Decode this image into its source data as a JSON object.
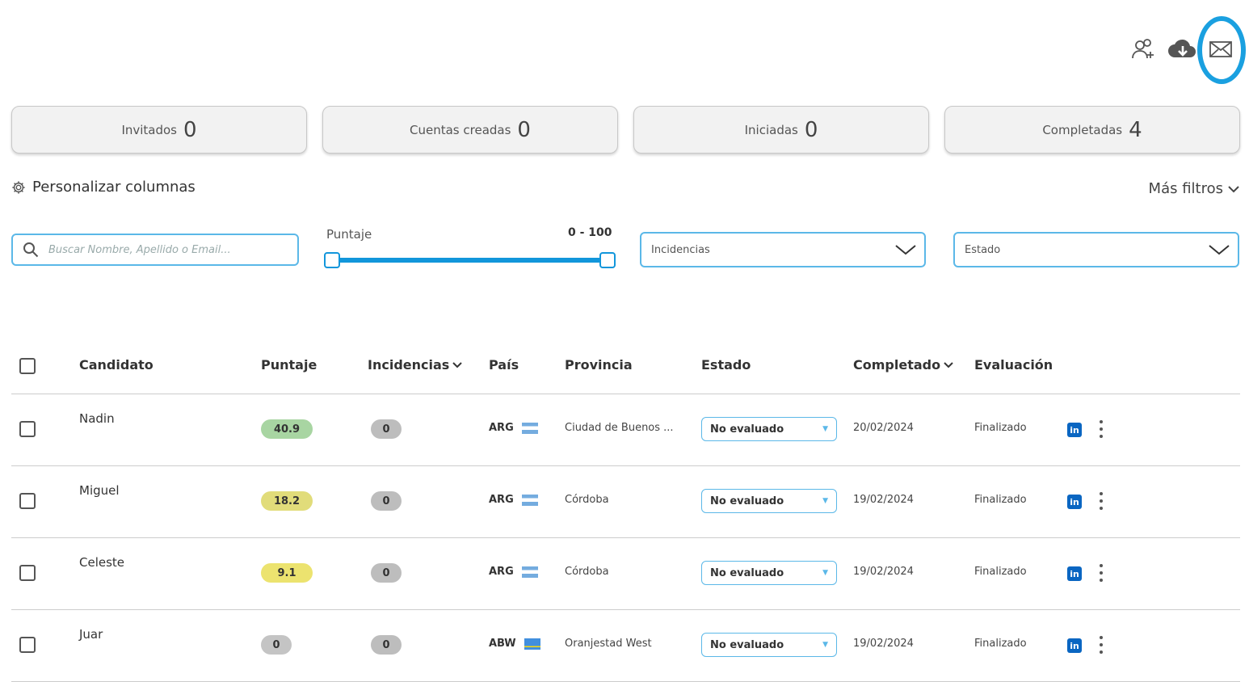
{
  "icons": {
    "add_user": "add-user-icon",
    "download": "cloud-download-icon",
    "email": "envelope-icon"
  },
  "stats": [
    {
      "label": "Invitados",
      "value": "0"
    },
    {
      "label": "Cuentas creadas",
      "value": "0"
    },
    {
      "label": "Iniciadas",
      "value": "0"
    },
    {
      "label": "Completadas",
      "value": "4"
    }
  ],
  "toolbar": {
    "personalize_label": "Personalizar columnas",
    "more_filters_label": "Más filtros"
  },
  "filters": {
    "search_placeholder": "Buscar Nombre, Apellido o Email...",
    "score_label": "Puntaje",
    "score_range": "0 - 100",
    "score_min": 0,
    "score_max": 100,
    "incidents_label": "Incidencias",
    "status_label": "Estado"
  },
  "table": {
    "headers": {
      "candidate": "Candidato",
      "score": "Puntaje",
      "incidents": "Incidencias",
      "country": "País",
      "province": "Provincia",
      "status": "Estado",
      "completed": "Completado",
      "evaluation": "Evaluación"
    },
    "rows": [
      {
        "name": "Nadin",
        "score": "40.9",
        "score_color": "#a8d5a2",
        "incidents": "0",
        "country": "ARG",
        "province": "Ciudad de Buenos ...",
        "status": "No evaluado",
        "completed": "20/02/2024",
        "evaluation": "Finalizado",
        "linkedin": "in"
      },
      {
        "name": "Miguel",
        "score": "18.2",
        "score_color": "#e1dc7a",
        "incidents": "0",
        "country": "ARG",
        "province": "Córdoba",
        "status": "No evaluado",
        "completed": "19/02/2024",
        "evaluation": "Finalizado",
        "linkedin": "in"
      },
      {
        "name": "Celeste",
        "score": "9.1",
        "score_color": "#ece36f",
        "incidents": "0",
        "country": "ARG",
        "province": "Córdoba",
        "status": "No evaluado",
        "completed": "19/02/2024",
        "evaluation": "Finalizado",
        "linkedin": "in"
      },
      {
        "name": "Juar",
        "score": "0",
        "score_color": "#c4c4c4",
        "incidents": "0",
        "country": "ABW",
        "province": "Oranjestad West",
        "status": "No evaluado",
        "completed": "19/02/2024",
        "evaluation": "Finalizado",
        "linkedin": "in"
      }
    ]
  },
  "colors": {
    "accent": "#1296db",
    "highlight": "#1aa0e0",
    "incident_pill": "#bdbdbd"
  }
}
